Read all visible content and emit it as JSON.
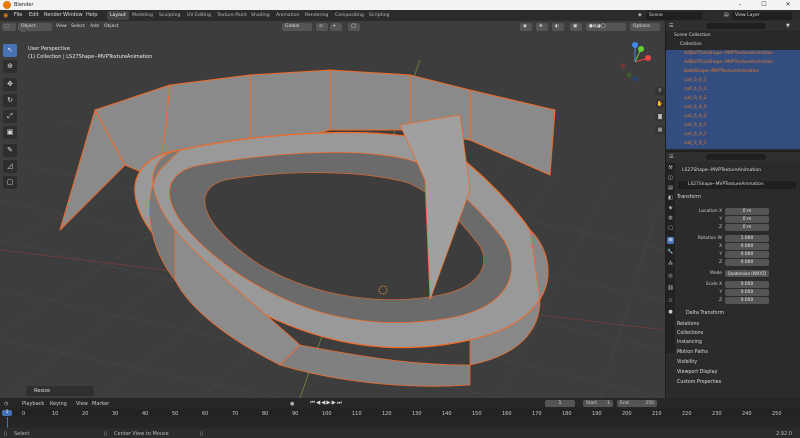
{
  "app": {
    "title": "Blender"
  },
  "menu": {
    "items": [
      "File",
      "Edit",
      "Render",
      "Window",
      "Help"
    ]
  },
  "workspaces": [
    {
      "label": "Layout",
      "active": true
    },
    {
      "label": "Modeling"
    },
    {
      "label": "Sculpting"
    },
    {
      "label": "UV Editing"
    },
    {
      "label": "Texture Paint"
    },
    {
      "label": "Shading"
    },
    {
      "label": "Animation"
    },
    {
      "label": "Rendering"
    },
    {
      "label": "Compositing"
    },
    {
      "label": "Scripting"
    }
  ],
  "top_right": {
    "scene": "Scene",
    "view_layer": "View Layer"
  },
  "viewport_header": {
    "mode": "Object Mode",
    "view": "View",
    "select": "Select",
    "add": "Add",
    "object": "Object",
    "orientation": "Global",
    "options": "Options"
  },
  "viewport": {
    "perspective": "User Perspective",
    "collection_line": "(1) Collection | LS27Shape--MVPTextureAnimation",
    "last_op": "Resize"
  },
  "outliner": {
    "header": "Scene Collection",
    "collection": "Collection",
    "items": [
      "AdBallTiresShape--MVPTextureAnimation",
      "AdBallTiresShape--MVPTextureAnimation",
      "BallsShape--MVPTextureAnimation",
      "cull_0_0_1",
      "cull_0_0_1",
      "cull_0_0_2",
      "cull_0_0_3",
      "cull_0_0_3",
      "cull_0_0_1",
      "cull_0_0_1",
      "cull_0_0_1"
    ]
  },
  "properties": {
    "object_name": "LS27Shape--MVPTextureAnimation",
    "data_name": "LS27Shape--MVPTextureAnimation",
    "transform": "Transform",
    "location_label": "Location X",
    "y": "Y",
    "z": "Z",
    "location": [
      "0 m",
      "0 m",
      "0 m"
    ],
    "rotation_label": "Rotation W",
    "rotation": [
      "1.000",
      "0.000",
      "0.000",
      "0.000"
    ],
    "x": "X",
    "mode_label": "Mode",
    "mode": "Quaternion (WXYZ)",
    "scale_label": "Scale X",
    "scale": [
      "0.050",
      "0.050",
      "0.050"
    ],
    "sections": [
      "Delta Transform",
      "Relations",
      "Collections",
      "Instancing",
      "Motion Paths",
      "Visibility",
      "Viewport Display",
      "Custom Properties"
    ]
  },
  "timeline": {
    "menus": [
      "Playback",
      "Keying",
      "View",
      "Marker"
    ],
    "ticks": [
      "0",
      "10",
      "20",
      "30",
      "40",
      "50",
      "60",
      "70",
      "80",
      "90",
      "100",
      "110",
      "120",
      "130",
      "140",
      "150",
      "160",
      "170",
      "180",
      "190",
      "200",
      "210",
      "220",
      "230",
      "240",
      "250"
    ],
    "current": "1",
    "start_label": "Start",
    "start": "1",
    "end_label": "End",
    "end": "250"
  },
  "status": {
    "select": "Select",
    "center": "Center View to Mouse",
    "version": "2.92.0"
  }
}
